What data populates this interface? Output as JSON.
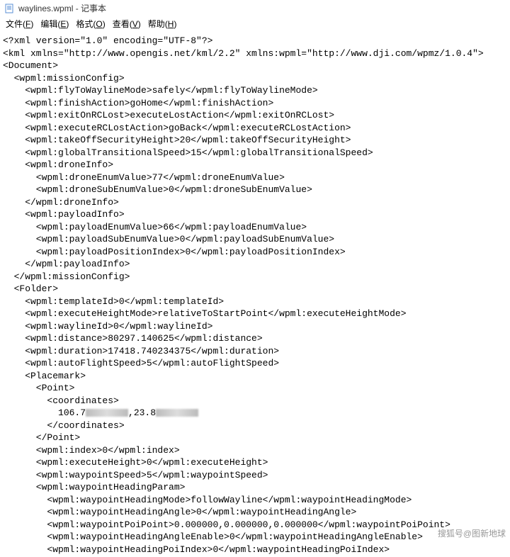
{
  "titlebar": {
    "text": "waylines.wpml - 记事本"
  },
  "menubar": {
    "items": [
      {
        "label": "文件",
        "accel": "F"
      },
      {
        "label": "编辑",
        "accel": "E"
      },
      {
        "label": "格式",
        "accel": "O"
      },
      {
        "label": "查看",
        "accel": "V"
      },
      {
        "label": "帮助",
        "accel": "H"
      }
    ]
  },
  "lines": [
    "<?xml version=\"1.0\" encoding=\"UTF-8\"?>",
    "<kml xmlns=\"http://www.opengis.net/kml/2.2\" xmlns:wpml=\"http://www.dji.com/wpmz/1.0.4\">",
    "<Document>",
    "  <wpml:missionConfig>",
    "    <wpml:flyToWaylineMode>safely</wpml:flyToWaylineMode>",
    "    <wpml:finishAction>goHome</wpml:finishAction>",
    "    <wpml:exitOnRCLost>executeLostAction</wpml:exitOnRCLost>",
    "    <wpml:executeRCLostAction>goBack</wpml:executeRCLostAction>",
    "    <wpml:takeOffSecurityHeight>20</wpml:takeOffSecurityHeight>",
    "    <wpml:globalTransitionalSpeed>15</wpml:globalTransitionalSpeed>",
    "    <wpml:droneInfo>",
    "      <wpml:droneEnumValue>77</wpml:droneEnumValue>",
    "      <wpml:droneSubEnumValue>0</wpml:droneSubEnumValue>",
    "    </wpml:droneInfo>",
    "    <wpml:payloadInfo>",
    "      <wpml:payloadEnumValue>66</wpml:payloadEnumValue>",
    "      <wpml:payloadSubEnumValue>0</wpml:payloadSubEnumValue>",
    "      <wpml:payloadPositionIndex>0</wpml:payloadPositionIndex>",
    "    </wpml:payloadInfo>",
    "  </wpml:missionConfig>",
    "  <Folder>",
    "    <wpml:templateId>0</wpml:templateId>",
    "    <wpml:executeHeightMode>relativeToStartPoint</wpml:executeHeightMode>",
    "    <wpml:waylineId>0</wpml:waylineId>",
    "    <wpml:distance>80297.140625</wpml:distance>",
    "    <wpml:duration>17418.740234375</wpml:duration>",
    "    <wpml:autoFlightSpeed>5</wpml:autoFlightSpeed>",
    "    <Placemark>",
    "      <Point>",
    "        <coordinates>",
    "          106.7[BLUR],23.8[BLUR]",
    "        </coordinates>",
    "      </Point>",
    "      <wpml:index>0</wpml:index>",
    "      <wpml:executeHeight>0</wpml:executeHeight>",
    "      <wpml:waypointSpeed>5</wpml:waypointSpeed>",
    "      <wpml:waypointHeadingParam>",
    "        <wpml:waypointHeadingMode>followWayline</wpml:waypointHeadingMode>",
    "        <wpml:waypointHeadingAngle>0</wpml:waypointHeadingAngle>",
    "        <wpml:waypointPoiPoint>0.000000,0.000000,0.000000</wpml:waypointPoiPoint>",
    "        <wpml:waypointHeadingAngleEnable>0</wpml:waypointHeadingAngleEnable>",
    "        <wpml:waypointHeadingPoiIndex>0</wpml:waypointHeadingPoiIndex>"
  ],
  "watermark": "搜狐号@图新地球"
}
